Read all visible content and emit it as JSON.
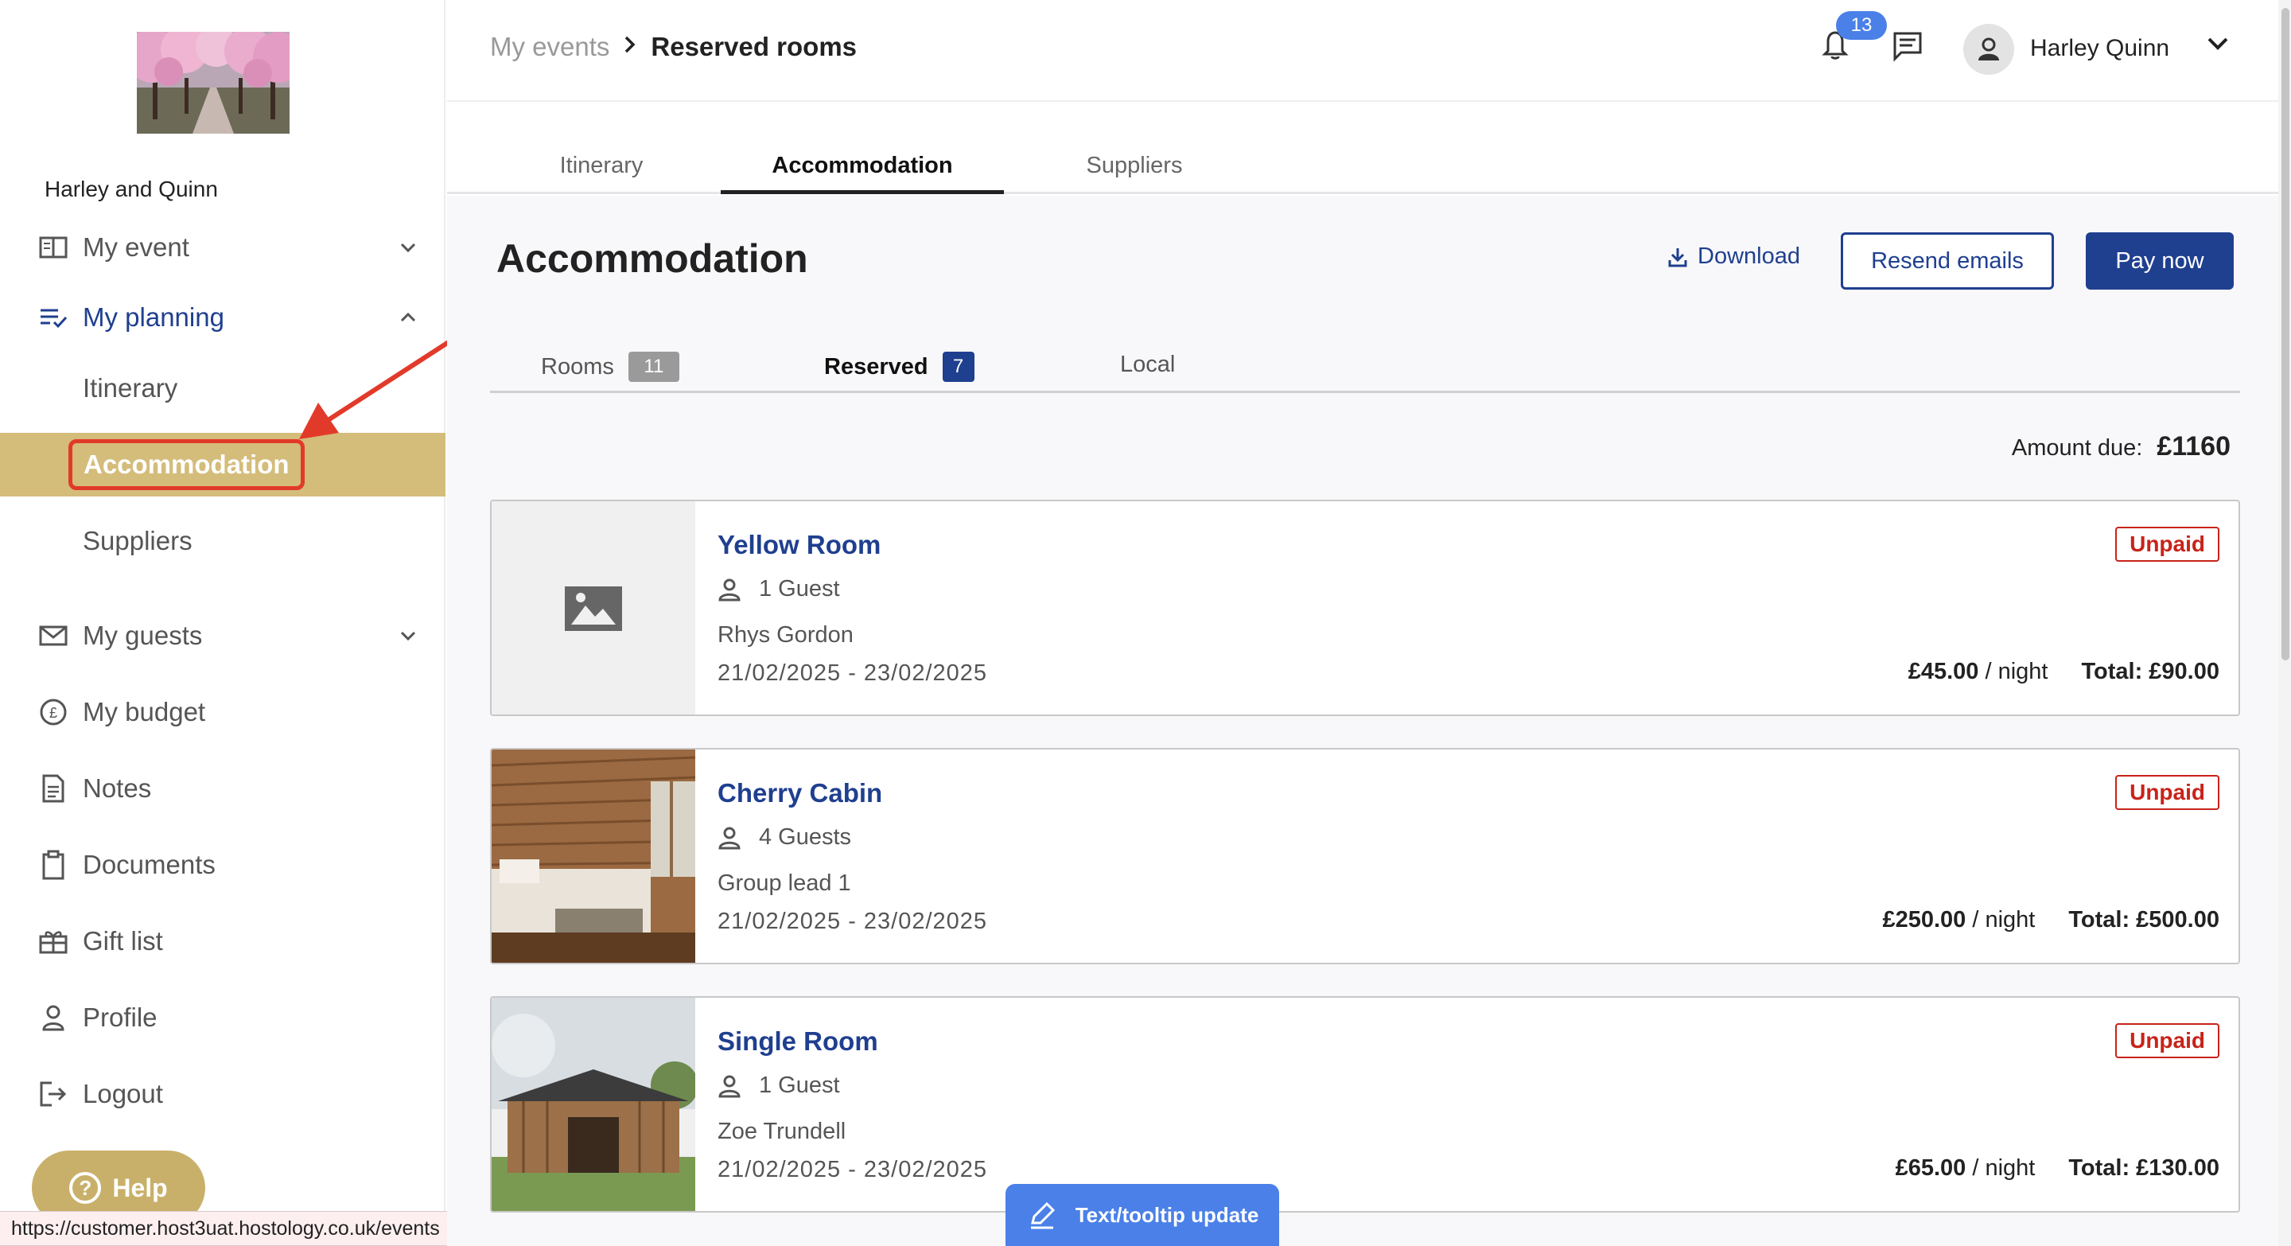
{
  "sidebar": {
    "couple_name": "Harley and Quinn",
    "items": [
      {
        "label": "My event",
        "icon": "book-open-icon"
      },
      {
        "label": "My planning",
        "icon": "checklist-icon"
      },
      {
        "label": "My guests",
        "icon": "mail-icon"
      },
      {
        "label": "My budget",
        "icon": "pound-coin-icon"
      },
      {
        "label": "Notes",
        "icon": "document-icon"
      },
      {
        "label": "Documents",
        "icon": "clipboard-icon"
      },
      {
        "label": "Gift list",
        "icon": "gift-icon"
      },
      {
        "label": "Profile",
        "icon": "person-icon"
      },
      {
        "label": "Logout",
        "icon": "logout-icon"
      }
    ],
    "planning_subitems": [
      "Itinerary",
      "Accommodation",
      "Suppliers"
    ],
    "help_label": "Help"
  },
  "status_url": "https://customer.host3uat.hostology.co.uk/events",
  "header": {
    "breadcrumb_parent": "My events",
    "breadcrumb_current": "Reserved rooms",
    "notification_count": "13",
    "user_name": "Harley Quinn"
  },
  "main_tabs": [
    "Itinerary",
    "Accommodation",
    "Suppliers"
  ],
  "page": {
    "title": "Accommodation",
    "download_label": "Download",
    "resend_label": "Resend emails",
    "pay_label": "Pay now",
    "subtabs": [
      {
        "label": "Rooms",
        "count": "11"
      },
      {
        "label": "Reserved",
        "count": "7"
      },
      {
        "label": "Local",
        "count": ""
      }
    ],
    "amount_due_label": "Amount due:",
    "amount_due_value": "£1160"
  },
  "rooms": [
    {
      "name": "Yellow Room",
      "guests": "1 Guest",
      "lead": "Rhys Gordon",
      "dates": "21/02/2025 - 23/02/2025",
      "status": "Unpaid",
      "price": "£45.00",
      "per": "/ night",
      "total": "Total: £90.00"
    },
    {
      "name": "Cherry Cabin",
      "guests": "4 Guests",
      "lead": "Group lead 1",
      "dates": "21/02/2025 - 23/02/2025",
      "status": "Unpaid",
      "price": "£250.00",
      "per": "/ night",
      "total": "Total: £500.00"
    },
    {
      "name": "Single Room",
      "guests": "1 Guest",
      "lead": "Zoe Trundell",
      "dates": "21/02/2025 - 23/02/2025",
      "status": "Unpaid",
      "price": "£65.00",
      "per": "/ night",
      "total": "Total: £130.00"
    }
  ],
  "tooltip_label": "Text/tooltip update",
  "colors": {
    "brand_blue": "#1f3f8f",
    "gold": "#d4bc7a",
    "unpaid_red": "#c8231a",
    "annotation_red": "#e23a2a",
    "badge_blue": "#4a80e8"
  }
}
